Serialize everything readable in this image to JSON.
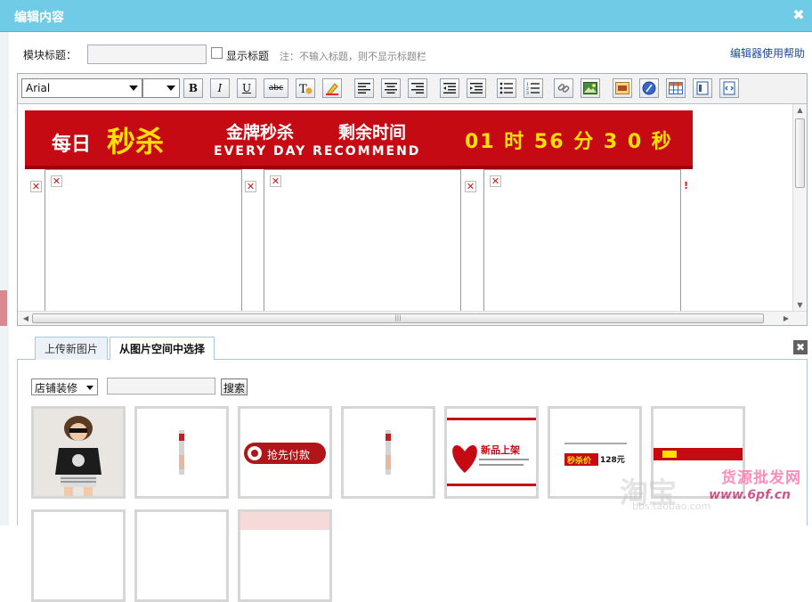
{
  "titlebar": {
    "title": "编辑内容",
    "close": "✖"
  },
  "form": {
    "title_label": "模块标题：",
    "title_value": "",
    "show_title_label": "显示标题",
    "note": "注：不输入标题，则不显示标题栏",
    "help_link": "编辑器使用帮助"
  },
  "toolbar": {
    "font_family": "Arial",
    "font_size": "",
    "bold": "B",
    "italic": "I",
    "underline": "U",
    "strike": "abc",
    "icons": [
      "format-clear-icon",
      "highlight-icon",
      "align-left-icon",
      "align-center-icon",
      "align-right-icon",
      "outdent-icon",
      "indent-icon",
      "bulleted-list-icon",
      "numbered-list-icon",
      "link-icon",
      "image-icon",
      "flash-icon",
      "media-icon",
      "table-icon",
      "template-icon",
      "source-icon"
    ]
  },
  "banner": {
    "daily": "每日",
    "flash_sale": "秒杀",
    "gold_sale": "金牌秒杀",
    "time_left": "剩余时间",
    "slogan": "EVERY DAY RECOMMEND",
    "countdown": "01 时  56 分 3 0 秒"
  },
  "image_panel": {
    "tabs": [
      "上传新图片",
      "从图片空间中选择"
    ],
    "active_tab": 1,
    "category": "店铺装修",
    "search_value": "",
    "search_button": "搜索",
    "close": "✖",
    "thumbs": [
      {
        "kind": "photo",
        "caption": ""
      },
      {
        "kind": "strip",
        "caption": ""
      },
      {
        "kind": "button",
        "caption": "抢先付款"
      },
      {
        "kind": "strip",
        "caption": ""
      },
      {
        "kind": "promo",
        "caption": "新品上架"
      },
      {
        "kind": "price",
        "caption": "秒杀价",
        "price": "128元"
      },
      {
        "kind": "banner",
        "caption": ""
      }
    ]
  },
  "watermark": {
    "brand": "货源批发网",
    "url": "www.6pf.cn",
    "logo": "淘宝",
    "sub": "bbs.taobao.com"
  },
  "colors": {
    "titlebar": "#6fcbe6",
    "banner": "#c60a14",
    "highlight": "#ffe000"
  }
}
